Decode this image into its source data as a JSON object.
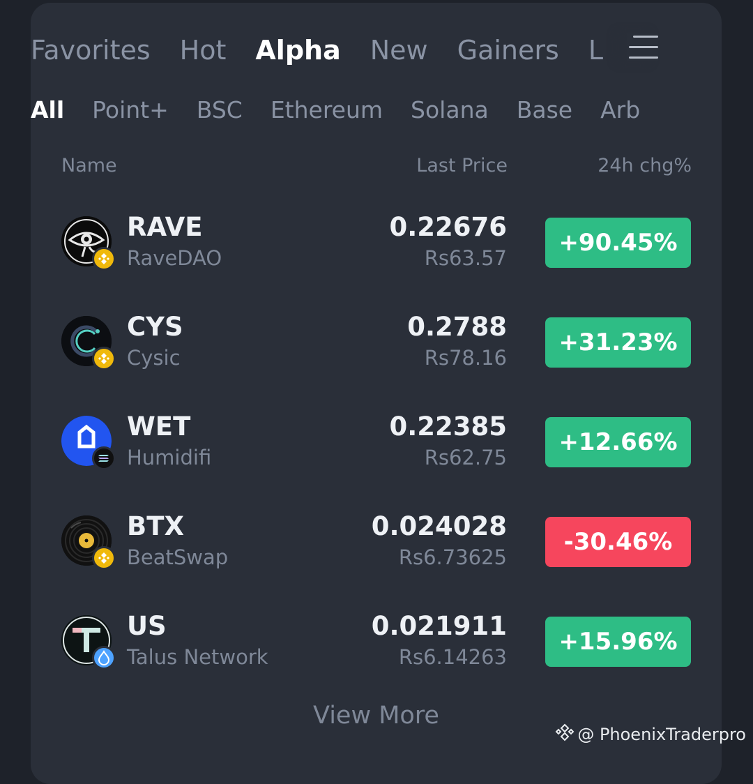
{
  "top_tabs": [
    {
      "label": "Favorites",
      "active": false
    },
    {
      "label": "Hot",
      "active": false
    },
    {
      "label": "Alpha",
      "active": true
    },
    {
      "label": "New",
      "active": false
    },
    {
      "label": "Gainers",
      "active": false
    },
    {
      "label": "L",
      "active": false
    }
  ],
  "chain_tabs": [
    {
      "label": "All",
      "active": true
    },
    {
      "label": "Point+",
      "active": false
    },
    {
      "label": "BSC",
      "active": false
    },
    {
      "label": "Ethereum",
      "active": false
    },
    {
      "label": "Solana",
      "active": false
    },
    {
      "label": "Base",
      "active": false
    },
    {
      "label": "Arb",
      "active": false
    }
  ],
  "columns": {
    "name": "Name",
    "last_price": "Last Price",
    "change": "24h chg%"
  },
  "rows": [
    {
      "symbol": "RAVE",
      "name": "RaveDAO",
      "price": "0.22676",
      "fiat": "Rs63.57",
      "change": "+90.45%",
      "direction": "up",
      "icon": "rave-eye-icon",
      "chain_icon": "bnb-chain-icon"
    },
    {
      "symbol": "CYS",
      "name": "Cysic",
      "price": "0.2788",
      "fiat": "Rs78.16",
      "change": "+31.23%",
      "direction": "up",
      "icon": "cysic-logo-icon",
      "chain_icon": "bnb-chain-icon"
    },
    {
      "symbol": "WET",
      "name": "Humidifi",
      "price": "0.22385",
      "fiat": "Rs62.75",
      "change": "+12.66%",
      "direction": "up",
      "icon": "humidifi-logo-icon",
      "chain_icon": "solana-chain-icon"
    },
    {
      "symbol": "BTX",
      "name": "BeatSwap",
      "price": "0.024028",
      "fiat": "Rs6.73625",
      "change": "-30.46%",
      "direction": "down",
      "icon": "vinyl-record-icon",
      "chain_icon": "bnb-chain-icon"
    },
    {
      "symbol": "US",
      "name": "Talus Network",
      "price": "0.021911",
      "fiat": "Rs6.14263",
      "change": "+15.96%",
      "direction": "up",
      "icon": "talus-logo-icon",
      "chain_icon": "sui-chain-icon"
    }
  ],
  "view_more": "View More",
  "watermark": "@ PhoenixTraderpro",
  "colors": {
    "up": "#2ebd85",
    "down": "#f6465d",
    "card_bg": "#2a2f39",
    "page_bg": "#1e222a"
  }
}
